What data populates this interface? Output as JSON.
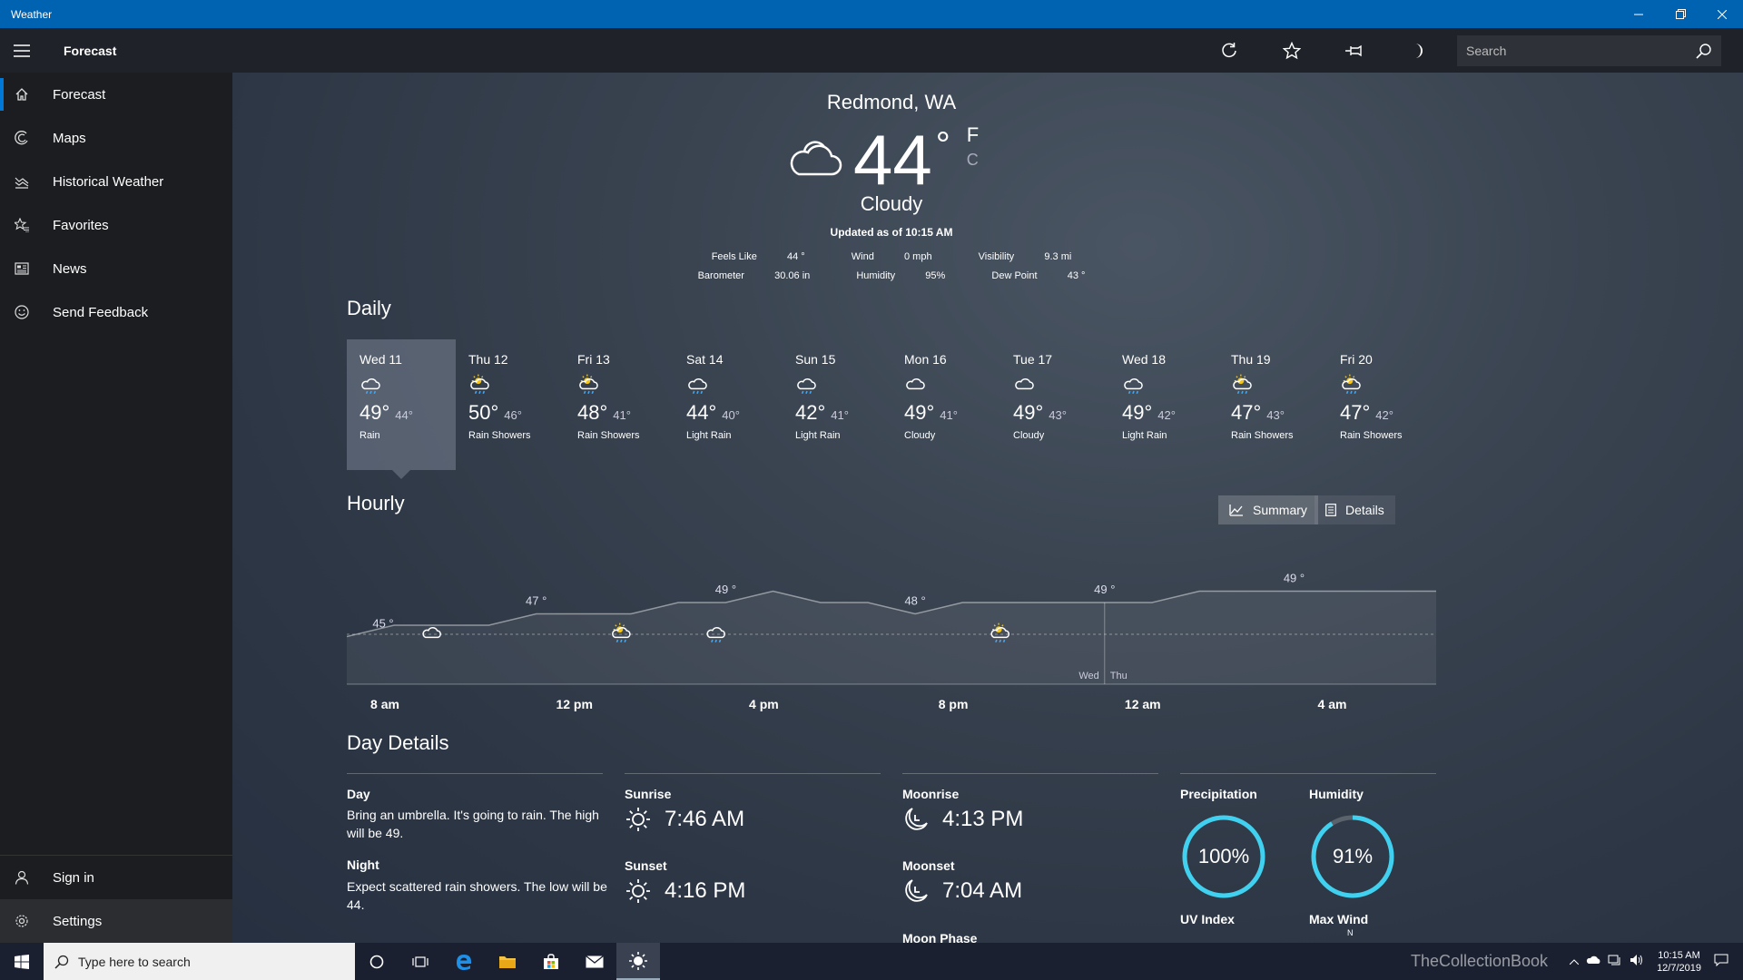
{
  "window": {
    "title": "Weather"
  },
  "appbar": {
    "page_title": "Forecast",
    "search_placeholder": "Search"
  },
  "sidebar": {
    "items": [
      {
        "label": "Forecast",
        "icon": "home-icon"
      },
      {
        "label": "Maps",
        "icon": "maps-icon"
      },
      {
        "label": "Historical Weather",
        "icon": "chart-icon"
      },
      {
        "label": "Favorites",
        "icon": "favorites-icon"
      },
      {
        "label": "News",
        "icon": "news-icon"
      },
      {
        "label": "Send Feedback",
        "icon": "smiley-icon"
      }
    ],
    "bottom": [
      {
        "label": "Sign in",
        "icon": "person-icon"
      },
      {
        "label": "Settings",
        "icon": "gear-icon"
      }
    ]
  },
  "current": {
    "city": "Redmond, WA",
    "temp": "44",
    "degree": "°",
    "unit_f": "F",
    "unit_c": "C",
    "condition": "Cloudy",
    "updated": "Updated as of 10:15 AM",
    "feels_like_label": "Feels Like",
    "feels_like": "44 °",
    "wind_label": "Wind",
    "wind": "0 mph",
    "visibility_label": "Visibility",
    "visibility": "9.3 mi",
    "barometer_label": "Barometer",
    "barometer": "30.06 in",
    "humidity_label": "Humidity",
    "humidity": "95%",
    "dewpoint_label": "Dew Point",
    "dewpoint": "43 °"
  },
  "daily": {
    "title": "Daily",
    "days": [
      {
        "name": "Wed 11",
        "hi": "49°",
        "lo": "44°",
        "desc": "Rain",
        "icon": "rain"
      },
      {
        "name": "Thu 12",
        "hi": "50°",
        "lo": "46°",
        "desc": "Rain Showers",
        "icon": "sun-rain"
      },
      {
        "name": "Fri 13",
        "hi": "48°",
        "lo": "41°",
        "desc": "Rain Showers",
        "icon": "sun-rain"
      },
      {
        "name": "Sat 14",
        "hi": "44°",
        "lo": "40°",
        "desc": "Light Rain",
        "icon": "rain"
      },
      {
        "name": "Sun 15",
        "hi": "42°",
        "lo": "41°",
        "desc": "Light Rain",
        "icon": "rain"
      },
      {
        "name": "Mon 16",
        "hi": "49°",
        "lo": "41°",
        "desc": "Cloudy",
        "icon": "cloud"
      },
      {
        "name": "Tue 17",
        "hi": "49°",
        "lo": "43°",
        "desc": "Cloudy",
        "icon": "cloud"
      },
      {
        "name": "Wed 18",
        "hi": "49°",
        "lo": "42°",
        "desc": "Light Rain",
        "icon": "rain"
      },
      {
        "name": "Thu 19",
        "hi": "47°",
        "lo": "43°",
        "desc": "Rain Showers",
        "icon": "sun-rain"
      },
      {
        "name": "Fri 20",
        "hi": "47°",
        "lo": "42°",
        "desc": "Rain Showers",
        "icon": "sun-rain"
      }
    ]
  },
  "hourly": {
    "title": "Hourly",
    "summary_label": "Summary",
    "details_label": "Details",
    "day_split_left": "Wed",
    "day_split_right": "Thu",
    "temp_labels": [
      {
        "x": 0,
        "text": "45 °"
      },
      {
        "x": 4,
        "text": "47 °"
      },
      {
        "x": 8,
        "text": "49 °"
      },
      {
        "x": 12,
        "text": "48 °"
      },
      {
        "x": 16,
        "text": "49 °"
      },
      {
        "x": 20,
        "text": "49 °"
      }
    ],
    "x_ticks": [
      "8 am",
      "12 pm",
      "4 pm",
      "8 pm",
      "12 am",
      "4 am"
    ],
    "temps": [
      45,
      46,
      46,
      46,
      47,
      47,
      47,
      48,
      48,
      49,
      48,
      48,
      47,
      48,
      48,
      48,
      48,
      48,
      49,
      49,
      49,
      49,
      49,
      49
    ],
    "icons": [
      {
        "x": 1,
        "icon": "cloud"
      },
      {
        "x": 5,
        "icon": "sun-rain"
      },
      {
        "x": 7,
        "icon": "rain"
      },
      {
        "x": 13,
        "icon": "sun-rain"
      }
    ]
  },
  "details": {
    "title": "Day Details",
    "day_label": "Day",
    "day_text": "Bring an umbrella. It's going to rain. The high will be 49.",
    "night_label": "Night",
    "night_text": "Expect scattered rain showers. The low will be 44.",
    "sunrise_label": "Sunrise",
    "sunrise": "7:46 AM",
    "sunset_label": "Sunset",
    "sunset": "4:16 PM",
    "moonrise_label": "Moonrise",
    "moonrise": "4:13 PM",
    "moonset_label": "Moonset",
    "moonset": "7:04 AM",
    "moonphase_label": "Moon Phase",
    "precip_label": "Precipitation",
    "precip": "100%",
    "precip_value": 1.0,
    "humidity_label": "Humidity",
    "humidity": "91%",
    "humidity_value": 0.91,
    "uv_label": "UV Index",
    "maxwind_label": "Max Wind",
    "maxwind_compass": "N"
  },
  "taskbar": {
    "search_placeholder": "Type here to search",
    "time": "10:15 AM",
    "date": "12/7/2019",
    "watermark": "TheCollectionBook"
  },
  "colors": {
    "accent": "#0078d7",
    "titlebar": "#0063b1",
    "ring": "#3fd1ef"
  }
}
